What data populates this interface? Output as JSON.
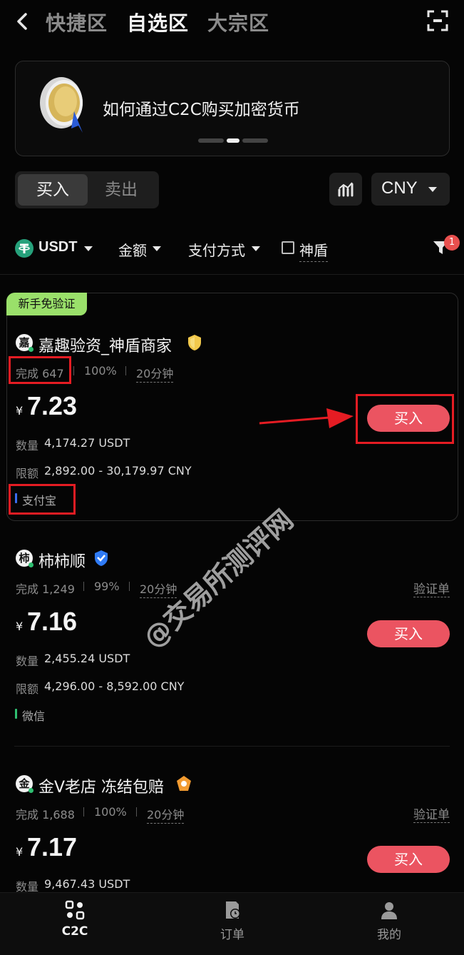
{
  "header": {
    "tabs": [
      {
        "label": "快捷区"
      },
      {
        "label": "自选区"
      },
      {
        "label": "大宗区"
      }
    ]
  },
  "banner": {
    "text": "如何通过C2C购买加密货币"
  },
  "trade_toggle": {
    "buy": "买入",
    "sell": "卖出"
  },
  "currency": {
    "label": "CNY"
  },
  "filters": {
    "coin": "USDT",
    "amount": "金额",
    "payment": "支付方式",
    "shield": "神盾",
    "badge_count": "1"
  },
  "ads": [
    {
      "tag": "新手免验证",
      "avatar_char": "嘉",
      "merchant": "嘉趣验资_神盾商家",
      "completed": "完成 647",
      "rate": "100%",
      "time": "20分钟",
      "currency_symbol": "¥",
      "price": "7.23",
      "qty_label": "数量",
      "qty": "4,174.27 USDT",
      "limit_label": "限额",
      "limit": "2,892.00 - 30,179.97 CNY",
      "payment": "支付宝",
      "buy": "买入"
    },
    {
      "avatar_char": "柿",
      "merchant": "柿柿顺",
      "completed": "完成 1,249",
      "rate": "99%",
      "time": "20分钟",
      "verify": "验证单",
      "currency_symbol": "¥",
      "price": "7.16",
      "qty_label": "数量",
      "qty": "2,455.24 USDT",
      "limit_label": "限额",
      "limit": "4,296.00 - 8,592.00 CNY",
      "payment": "微信",
      "buy": "买入"
    },
    {
      "avatar_char": "金",
      "merchant": "金V老店 冻结包赔",
      "completed": "完成 1,688",
      "rate": "100%",
      "time": "20分钟",
      "verify": "验证单",
      "currency_symbol": "¥",
      "price": "7.17",
      "qty_label": "数量",
      "qty": "9,467.43 USDT",
      "buy": "买入"
    }
  ],
  "watermark": "@交易所测评网",
  "bottom_nav": [
    {
      "label": "C2C",
      "icon": "c2c-icon"
    },
    {
      "label": "订单",
      "icon": "order-icon"
    },
    {
      "label": "我的",
      "icon": "profile-icon"
    }
  ],
  "colors": {
    "buy": "#eb5461",
    "newbie_tag": "#9ae06a",
    "alipay": "#3a6df0",
    "wechat": "#2fbf71",
    "annotation": "#e51c23"
  }
}
